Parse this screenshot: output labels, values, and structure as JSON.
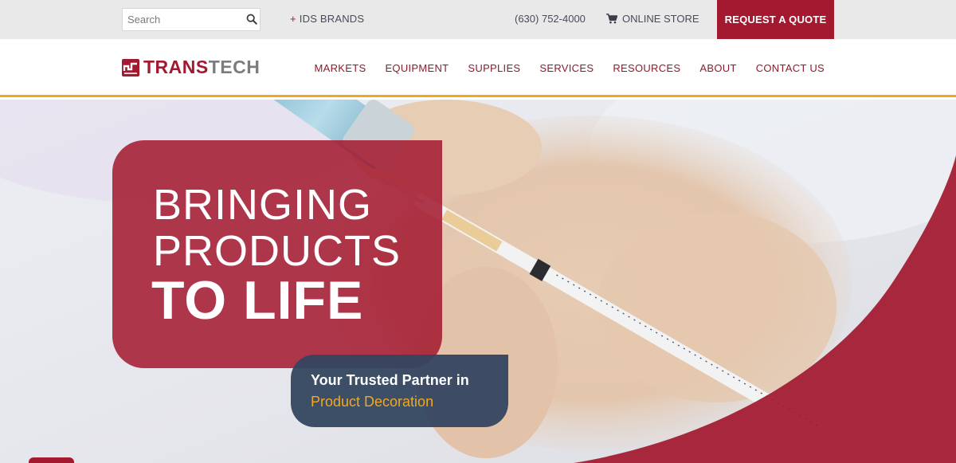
{
  "topbar": {
    "search_placeholder": "Search",
    "ids_brands_prefix": "+",
    "ids_brands_label": "IDS BRANDS",
    "phone": "(630) 752-4000",
    "store_label": "ONLINE STORE",
    "quote_label": "REQUEST A QUOTE"
  },
  "header": {
    "logo_trans": "TRANS",
    "logo_tech": "TECH",
    "nav": [
      "MARKETS",
      "EQUIPMENT",
      "SUPPLIES",
      "SERVICES",
      "RESOURCES",
      "ABOUT",
      "CONTACT US"
    ]
  },
  "hero": {
    "headline_line1": "BRINGING",
    "headline_line2": "PRODUCTS",
    "headline_line3": "TO LIFE",
    "partner_line1": "Your Trusted Partner in",
    "partner_line2": "Product Decoration"
  },
  "colors": {
    "brand_red": "#a3192f",
    "accent_gold": "#f1a81e",
    "navy": "#344660",
    "gray": "#7b7b80"
  },
  "icons": [
    "search-icon",
    "cart-icon",
    "logo-mark-icon"
  ]
}
